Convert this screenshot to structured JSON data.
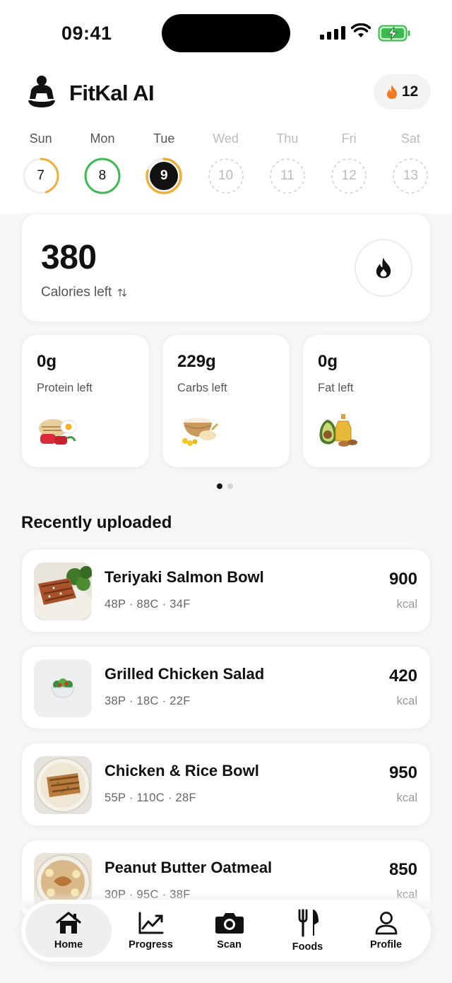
{
  "status_bar": {
    "time": "09:41"
  },
  "header": {
    "app_name": "FitKal AI",
    "streak_count": "12"
  },
  "week": [
    {
      "day": "Sun",
      "date": "7",
      "state": "partial",
      "progress": 0.45,
      "ring_color": "#e9b13c"
    },
    {
      "day": "Mon",
      "date": "8",
      "state": "complete",
      "progress": 1.0,
      "ring_color": "#3cba4f"
    },
    {
      "day": "Tue",
      "date": "9",
      "state": "today",
      "progress": 0.8,
      "ring_color": "#e9b13c"
    },
    {
      "day": "Wed",
      "date": "10",
      "state": "future"
    },
    {
      "day": "Thu",
      "date": "11",
      "state": "future"
    },
    {
      "day": "Fri",
      "date": "12",
      "state": "future"
    },
    {
      "day": "Sat",
      "date": "13",
      "state": "future"
    }
  ],
  "calories": {
    "value": "380",
    "label": "Calories left"
  },
  "macros": [
    {
      "value": "0g",
      "label": "Protein left",
      "icon": "protein-food-icon"
    },
    {
      "value": "229g",
      "label": "Carbs left",
      "icon": "carbs-food-icon"
    },
    {
      "value": "0g",
      "label": "Fat left",
      "icon": "fat-food-icon"
    }
  ],
  "pager": {
    "pages": 2,
    "active": 0
  },
  "recent": {
    "title": "Recently uploaded",
    "items": [
      {
        "name": "Teriyaki Salmon Bowl",
        "macros": "48P · 88C · 34F",
        "kcal": "900",
        "unit": "kcal"
      },
      {
        "name": "Grilled Chicken Salad",
        "macros": "38P · 18C · 22F",
        "kcal": "420",
        "unit": "kcal"
      },
      {
        "name": "Chicken & Rice Bowl",
        "macros": "55P · 110C · 28F",
        "kcal": "950",
        "unit": "kcal"
      },
      {
        "name": "Peanut Butter Oatmeal",
        "macros": "30P · 95C · 38F",
        "kcal": "850",
        "unit": "kcal"
      }
    ]
  },
  "tabs": [
    {
      "label": "Home",
      "icon": "home-icon",
      "active": true
    },
    {
      "label": "Progress",
      "icon": "progress-chart-icon"
    },
    {
      "label": "Scan",
      "icon": "camera-icon"
    },
    {
      "label": "Foods",
      "icon": "fork-knife-icon"
    },
    {
      "label": "Profile",
      "icon": "person-icon"
    }
  ]
}
